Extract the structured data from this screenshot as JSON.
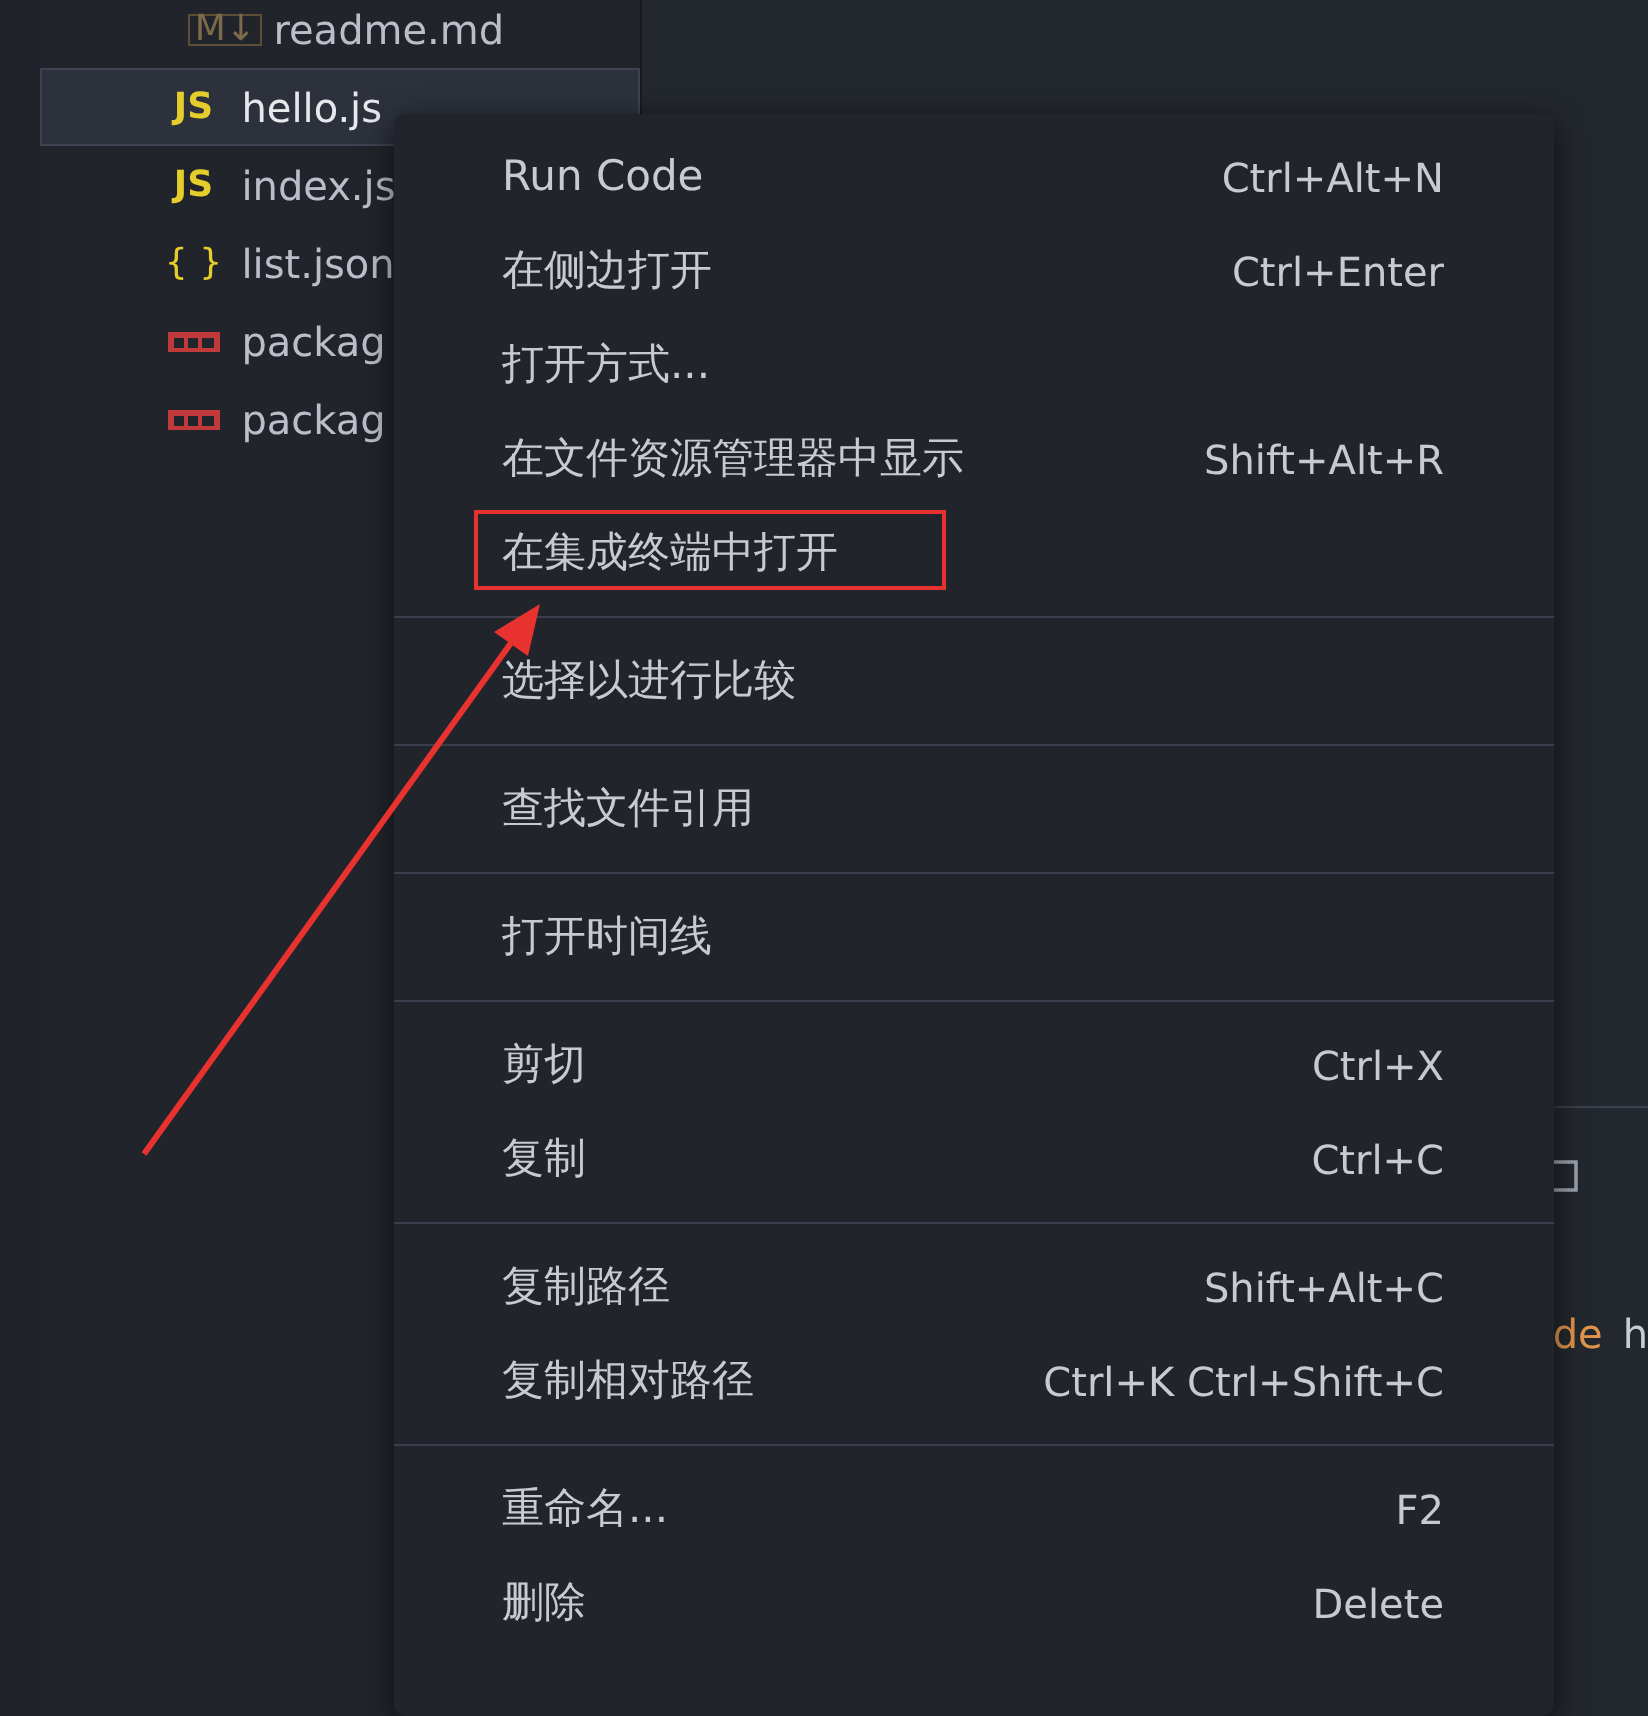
{
  "explorer": {
    "files": [
      {
        "name": "readme.md",
        "kind": "md",
        "icon": "M↓",
        "nested": true,
        "selected": false
      },
      {
        "name": "hello.js",
        "kind": "js",
        "icon": "JS",
        "nested": false,
        "selected": true
      },
      {
        "name": "index.js",
        "kind": "js",
        "icon": "JS",
        "nested": false,
        "selected": false
      },
      {
        "name": "list.json",
        "kind": "json",
        "icon": "{ }",
        "nested": false,
        "selected": false
      },
      {
        "name": "packag",
        "kind": "npm",
        "nested": false,
        "selected": false
      },
      {
        "name": "packag",
        "kind": "npm",
        "nested": false,
        "selected": false
      }
    ]
  },
  "editor": {
    "texts": [
      {
        "text": "de",
        "kind": "keyword"
      },
      {
        "text": "h",
        "kind": "plain"
      }
    ]
  },
  "context_menu": {
    "groups": [
      [
        {
          "label": "Run Code",
          "shortcut": "Ctrl+Alt+N",
          "annotated": false
        },
        {
          "label": "在侧边打开",
          "shortcut": "Ctrl+Enter",
          "annotated": false
        },
        {
          "label": "打开方式...",
          "annotated": false
        },
        {
          "label": "在文件资源管理器中显示",
          "shortcut": "Shift+Alt+R",
          "annotated": false
        },
        {
          "label": "在集成终端中打开",
          "annotated": true
        }
      ],
      [
        {
          "label": "选择以进行比较",
          "annotated": false
        }
      ],
      [
        {
          "label": "查找文件引用",
          "annotated": false
        }
      ],
      [
        {
          "label": "打开时间线",
          "annotated": false
        }
      ],
      [
        {
          "label": "剪切",
          "shortcut": "Ctrl+X",
          "annotated": false
        },
        {
          "label": "复制",
          "shortcut": "Ctrl+C",
          "annotated": false
        }
      ],
      [
        {
          "label": "复制路径",
          "shortcut": "Shift+Alt+C",
          "annotated": false
        },
        {
          "label": "复制相对路径",
          "shortcut": "Ctrl+K Ctrl+Shift+C",
          "annotated": false
        }
      ],
      [
        {
          "label": "重命名...",
          "shortcut": "F2",
          "annotated": false
        },
        {
          "label": "删除",
          "shortcut": "Delete",
          "annotated": false
        }
      ]
    ]
  }
}
